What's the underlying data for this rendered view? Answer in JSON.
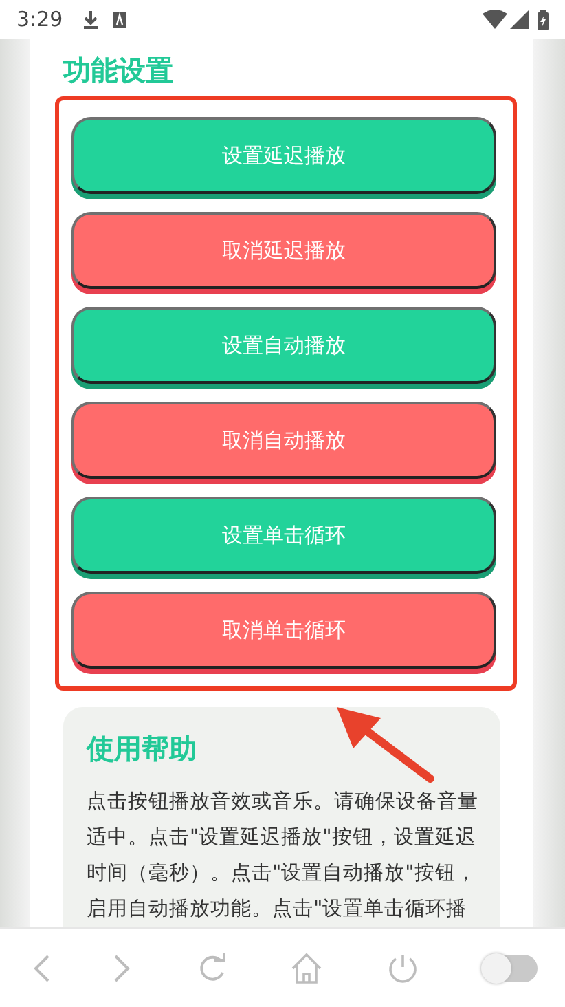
{
  "status_bar": {
    "time": "3:29"
  },
  "settings": {
    "title": "功能设置",
    "buttons": [
      {
        "label": "设置延迟播放",
        "kind": "set"
      },
      {
        "label": "取消延迟播放",
        "kind": "cancel"
      },
      {
        "label": "设置自动播放",
        "kind": "set"
      },
      {
        "label": "取消自动播放",
        "kind": "cancel"
      },
      {
        "label": "设置单击循环",
        "kind": "set"
      },
      {
        "label": "取消单击循环",
        "kind": "cancel"
      }
    ]
  },
  "help": {
    "title": "使用帮助",
    "text": "点击按钮播放音效或音乐。请确保设备音量适中。点击\"设置延迟播放\"按钮，设置延迟时间（毫秒）。点击\"设置自动播放\"按钮，启用自动播放功能。点击\"设置单击循环播"
  },
  "browser_bar": {
    "toggle": {
      "on": false
    }
  }
}
